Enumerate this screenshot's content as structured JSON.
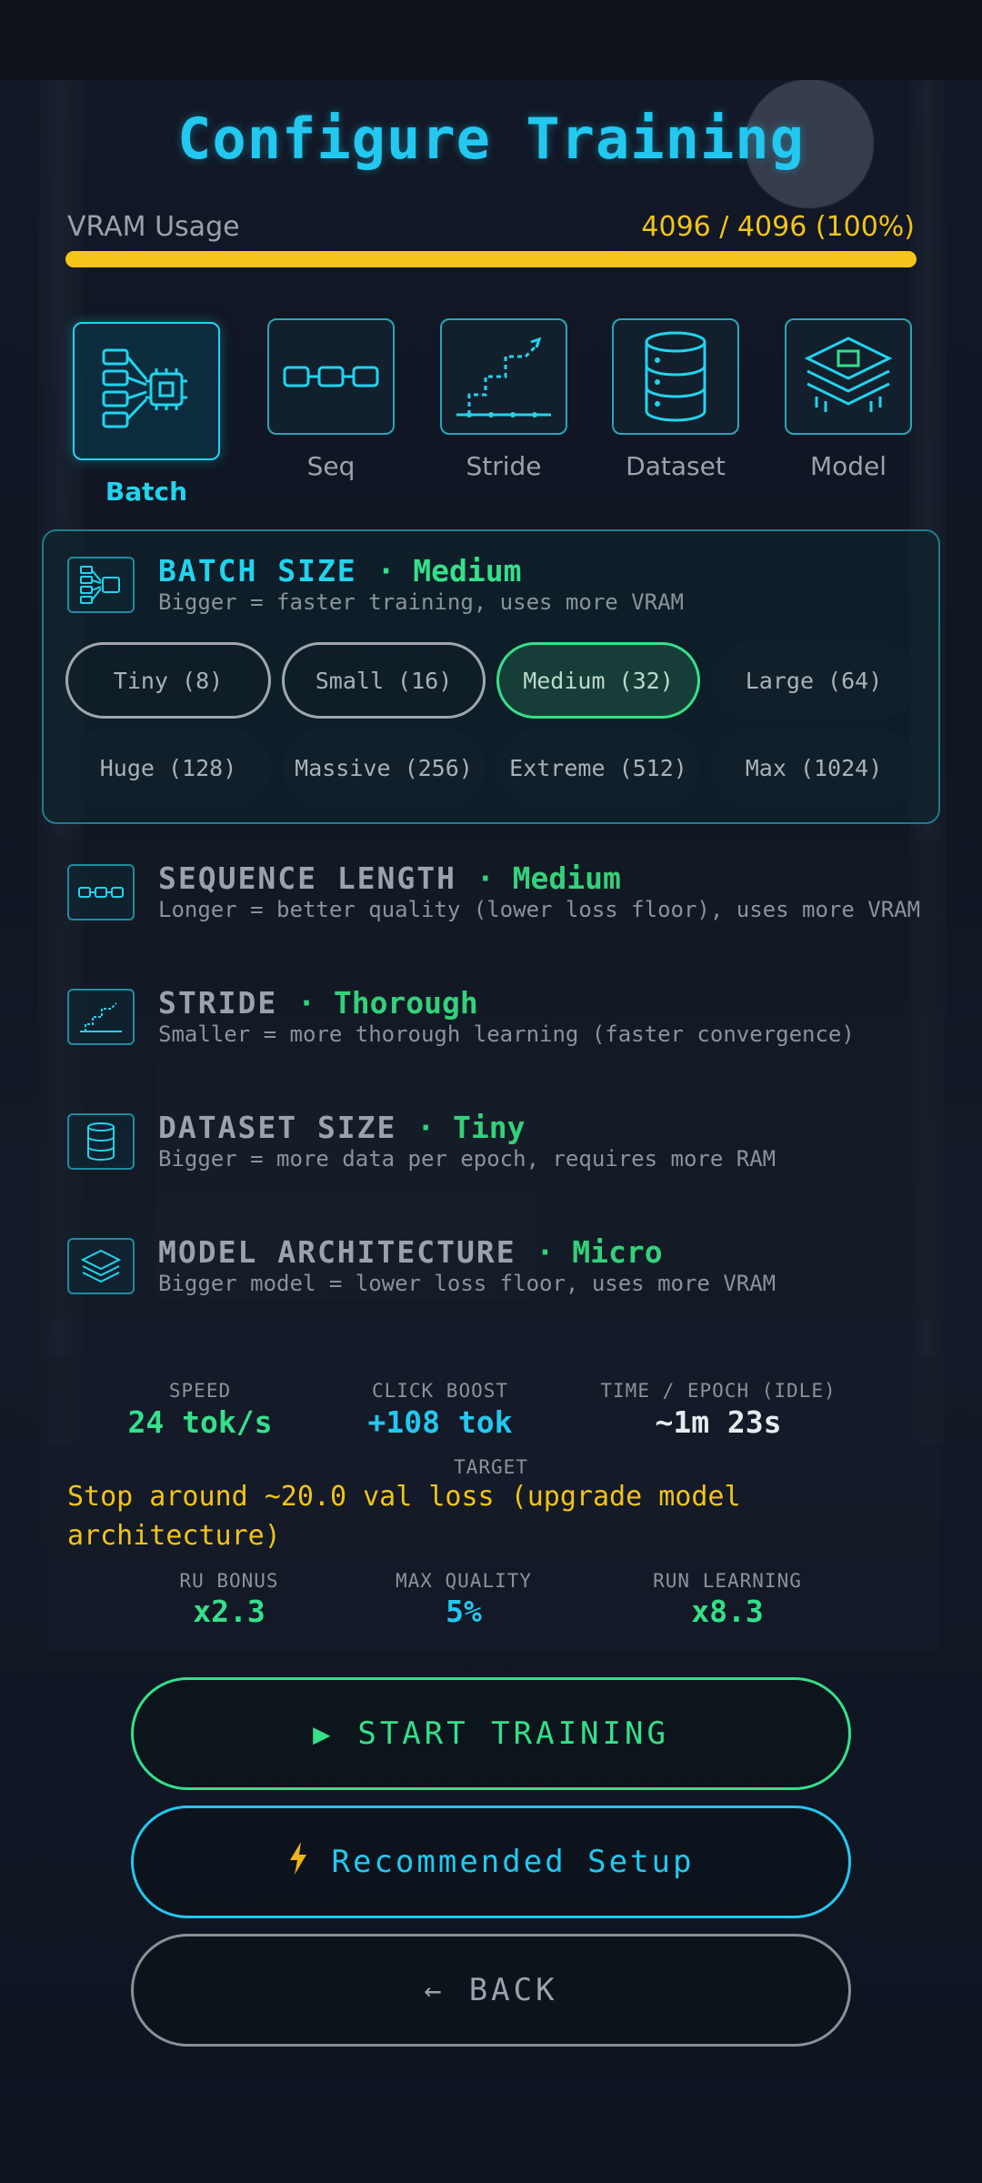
{
  "title": "Configure Training",
  "vram": {
    "label": "VRAM Usage",
    "value": "4096 / 4096 (100%)",
    "fill_percent": 100
  },
  "categories": [
    {
      "label": "Batch",
      "icon": "batch-network-icon",
      "active": true
    },
    {
      "label": "Seq",
      "icon": "sequence-chain-icon"
    },
    {
      "label": "Stride",
      "icon": "stride-steps-icon"
    },
    {
      "label": "Dataset",
      "icon": "database-icon"
    },
    {
      "label": "Model",
      "icon": "model-layers-icon"
    }
  ],
  "batch": {
    "title": "BATCH SIZE",
    "value": "· Medium",
    "desc": "Bigger = faster training, uses more VRAM",
    "options": [
      "Tiny (8)",
      "Small (16)",
      "Medium (32)",
      "Large (64)",
      "Huge (128)",
      "Massive (256)",
      "Extreme (512)",
      "Max (1024)"
    ],
    "selected_index": 2
  },
  "settings": [
    {
      "title": "SEQUENCE LENGTH",
      "value": "· Medium",
      "desc": "Longer = better quality (lower loss floor), uses more VRAM"
    },
    {
      "title": "STRIDE",
      "value": "· Thorough",
      "desc": "Smaller = more thorough learning (faster convergence)"
    },
    {
      "title": "DATASET SIZE",
      "value": "· Tiny",
      "desc": "Bigger = more data per epoch, requires more RAM"
    },
    {
      "title": "MODEL ARCHITECTURE",
      "value": "· Micro",
      "desc": "Bigger model = lower loss floor, uses more VRAM"
    }
  ],
  "stats": {
    "speed_label": "SPEED",
    "speed_value": "24 tok/s",
    "boost_label": "CLICK BOOST",
    "boost_value": "+108 tok",
    "time_label": "TIME / EPOCH (IDLE)",
    "time_value": "~1m 23s",
    "target_label": "TARGET",
    "target_text": "Stop around ~20.0 val loss (upgrade model architecture)",
    "ru_label": "RU BONUS",
    "ru_value": "x2.3",
    "quality_label": "MAX QUALITY",
    "quality_value": "5%",
    "learning_label": "RUN LEARNING",
    "learning_value": "x8.3"
  },
  "buttons": {
    "start": "START TRAINING",
    "recommended": "Recommended Setup",
    "back": "BACK"
  },
  "colors": {
    "accent_cyan": "#22c8f0",
    "accent_green": "#34e08a",
    "accent_yellow": "#f5c518"
  }
}
